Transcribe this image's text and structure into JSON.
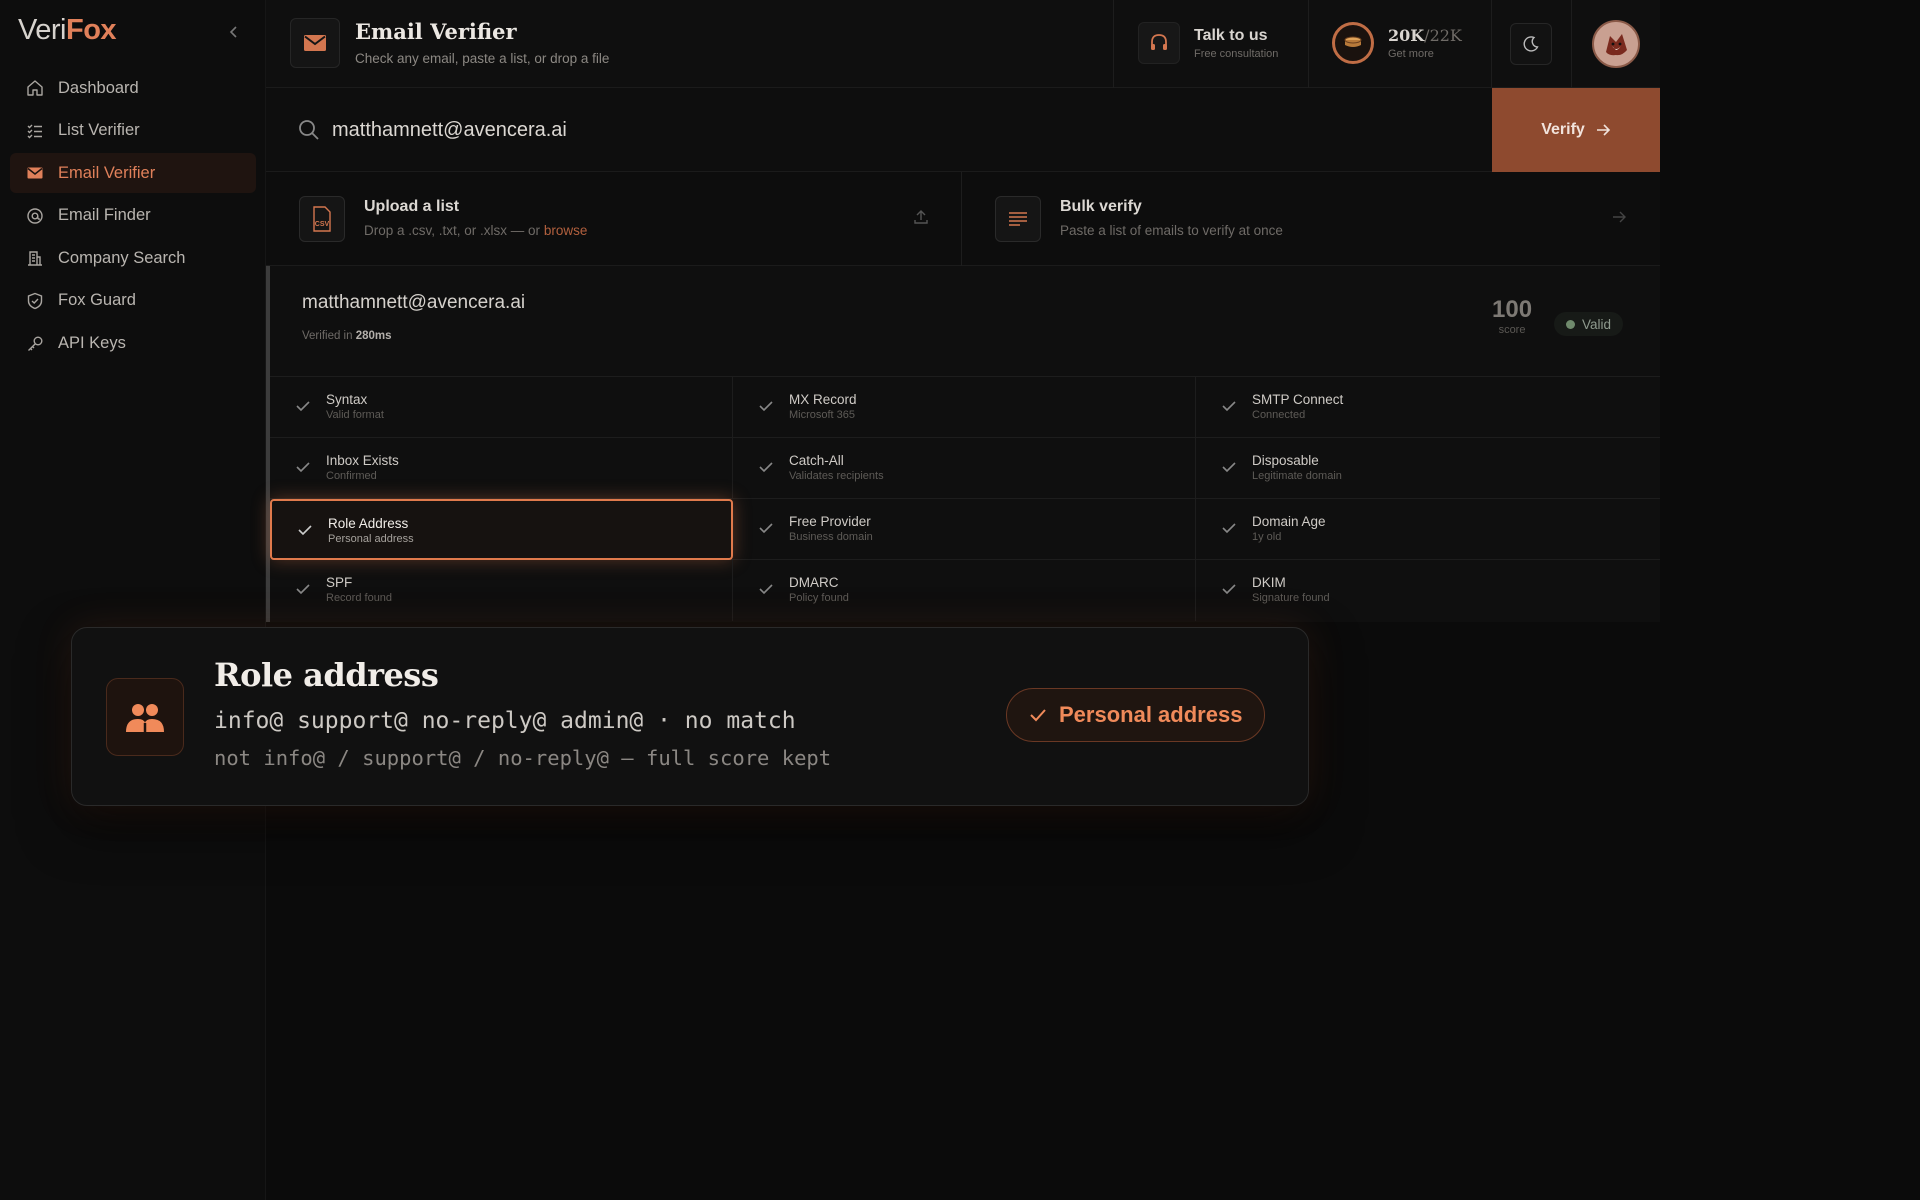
{
  "brand": {
    "part1": "Veri",
    "part2": "Fox"
  },
  "sidebar": {
    "items": [
      {
        "label": "Dashboard",
        "icon": "home-icon"
      },
      {
        "label": "List Verifier",
        "icon": "list-icon"
      },
      {
        "label": "Email Verifier",
        "icon": "mail-icon",
        "active": true
      },
      {
        "label": "Email Finder",
        "icon": "at-icon"
      },
      {
        "label": "Company Search",
        "icon": "building-icon"
      },
      {
        "label": "Fox Guard",
        "icon": "shield-icon"
      },
      {
        "label": "API Keys",
        "icon": "key-icon"
      }
    ]
  },
  "header": {
    "title": "Email Verifier",
    "subtitle": "Check any email, paste a list, or drop a file",
    "talk_title": "Talk to us",
    "talk_sub": "Free consultation",
    "credits_used": "20K",
    "credits_max": "/22K",
    "credits_sub": "Get more"
  },
  "search": {
    "value": "matthamnett@avencera.ai",
    "button": "Verify"
  },
  "upload": {
    "title": "Upload a list",
    "sub_prefix": "Drop a .csv, .txt, or .xlsx — or",
    "sub_link": "browse",
    "icon_text": "CSV"
  },
  "bulk": {
    "title": "Bulk verify",
    "sub": "Paste a list of emails to verify at once"
  },
  "result": {
    "email": "matthamnett@avencera.ai",
    "verified_prefix": "Verified in",
    "verified_time": "280ms",
    "score": "100",
    "score_label": "score",
    "status": "Valid",
    "checks": [
      [
        {
          "t": "Syntax",
          "s": "Valid format"
        },
        {
          "t": "MX Record",
          "s": "Microsoft 365"
        },
        {
          "t": "SMTP Connect",
          "s": "Connected"
        }
      ],
      [
        {
          "t": "Inbox Exists",
          "s": "Confirmed"
        },
        {
          "t": "Catch-All",
          "s": "Validates recipients"
        },
        {
          "t": "Disposable",
          "s": "Legitimate domain"
        }
      ],
      [
        {
          "t": "Role Address",
          "s": "Personal address"
        },
        {
          "t": "Free Provider",
          "s": "Business domain"
        },
        {
          "t": "Domain Age",
          "s": "1y old"
        }
      ],
      [
        {
          "t": "SPF",
          "s": "Record found"
        },
        {
          "t": "DMARC",
          "s": "Policy found"
        },
        {
          "t": "DKIM",
          "s": "Signature found"
        }
      ]
    ]
  },
  "popup": {
    "title": "Role address",
    "line1": "info@ support@ no-reply@ admin@ · no match",
    "line2": "not info@ / support@ / no-reply@ — full score kept",
    "badge": "Personal address"
  },
  "colors": {
    "accent": "#e0805a",
    "verify_btn": "#8e4a2f",
    "bg": "#0b0b0b"
  }
}
